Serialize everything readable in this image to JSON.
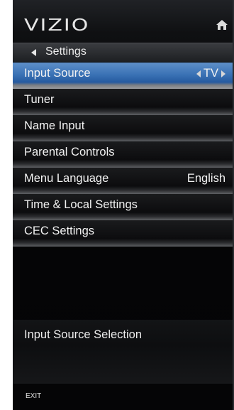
{
  "header": {
    "brand": "VIZIO",
    "home_icon": "home-icon"
  },
  "nav": {
    "back_label": "Settings",
    "back_icon": "back-arrow-icon"
  },
  "menu": {
    "items": [
      {
        "label": "Input Source",
        "value": "TV",
        "selected": true
      },
      {
        "label": "Tuner"
      },
      {
        "label": "Name Input"
      },
      {
        "label": "Parental Controls"
      },
      {
        "label": "Menu Language",
        "value": "English"
      },
      {
        "label": "Time & Local Settings"
      },
      {
        "label": "CEC Settings"
      }
    ]
  },
  "description": {
    "text": "Input Source Selection"
  },
  "footer": {
    "exit_label": "EXIT"
  },
  "colors": {
    "selected_highlight": "#3b73b6",
    "background": "#060607",
    "text": "#f2f2f2"
  }
}
